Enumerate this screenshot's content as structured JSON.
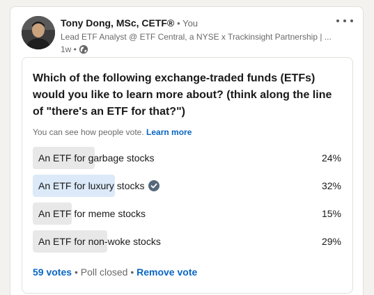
{
  "post": {
    "author_name": "Tony Dong, MSc, CETF®",
    "connection": "• You",
    "headline": "Lead ETF Analyst @ ETF Central, a NYSE x Trackinsight Partnership | ...",
    "time": "1w •",
    "visibility_icon": "globe-icon",
    "more_icon": "ellipsis-icon"
  },
  "poll": {
    "question": "Which of the following exchange-traded funds (ETFs) would you like to learn more about? (think along the line of \"there's an ETF for that?\")",
    "visibility_text": "You can see how people vote.",
    "learn_more": "Learn more",
    "options": [
      {
        "label": "An ETF for garbage stocks",
        "percent": "24%",
        "fraction": 0.24,
        "selected": false
      },
      {
        "label": "An ETF for luxury stocks",
        "percent": "32%",
        "fraction": 0.32,
        "selected": true
      },
      {
        "label": "An ETF for meme stocks",
        "percent": "15%",
        "fraction": 0.15,
        "selected": false
      },
      {
        "label": "An ETF for non-woke stocks",
        "percent": "29%",
        "fraction": 0.29,
        "selected": false
      }
    ],
    "votes": "59 votes",
    "sep1": "•",
    "status": "Poll closed",
    "sep2": "•",
    "remove_vote": "Remove vote"
  },
  "colors": {
    "link": "#0a66c2",
    "bar": "#e8e8e8",
    "bar_selected": "#dce9f8",
    "check": "#56687a"
  }
}
